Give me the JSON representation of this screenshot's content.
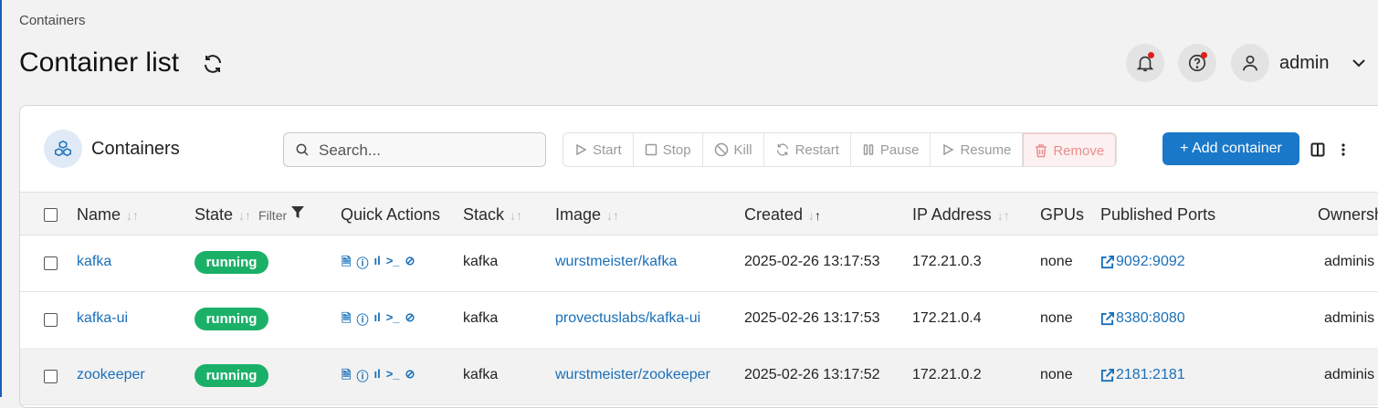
{
  "breadcrumb": "Containers",
  "title": "Container list",
  "header": {
    "username": "admin"
  },
  "card": {
    "title": "Containers",
    "search_placeholder": "Search...",
    "actions": {
      "start": "Start",
      "stop": "Stop",
      "kill": "Kill",
      "restart": "Restart",
      "pause": "Pause",
      "resume": "Resume",
      "remove": "Remove"
    },
    "add_label": "+ Add container"
  },
  "table": {
    "columns": {
      "name": "Name",
      "state": "State",
      "state_filter": "Filter",
      "quick_actions": "Quick Actions",
      "stack": "Stack",
      "image": "Image",
      "created": "Created",
      "ip": "IP Address",
      "gpus": "GPUs",
      "ports": "Published Ports",
      "ownership": "Ownersh"
    },
    "rows": [
      {
        "name": "kafka",
        "state": "running",
        "stack": "kafka",
        "image": "wurstmeister/kafka",
        "created": "2025-02-26 13:17:53",
        "ip": "172.21.0.3",
        "gpus": "none",
        "ports": "9092:9092",
        "ownership": "adminis"
      },
      {
        "name": "kafka-ui",
        "state": "running",
        "stack": "kafka",
        "image": "provectuslabs/kafka-ui",
        "created": "2025-02-26 13:17:53",
        "ip": "172.21.0.4",
        "gpus": "none",
        "ports": "8380:8080",
        "ownership": "adminis"
      },
      {
        "name": "zookeeper",
        "state": "running",
        "stack": "kafka",
        "image": "wurstmeister/zookeeper",
        "created": "2025-02-26 13:17:52",
        "ip": "172.21.0.2",
        "gpus": "none",
        "ports": "2181:2181",
        "ownership": "adminis"
      }
    ]
  },
  "colors": {
    "accent": "#1a78c8",
    "running": "#1bb068",
    "link": "#1a6fb8",
    "danger": "#e88f8f"
  }
}
